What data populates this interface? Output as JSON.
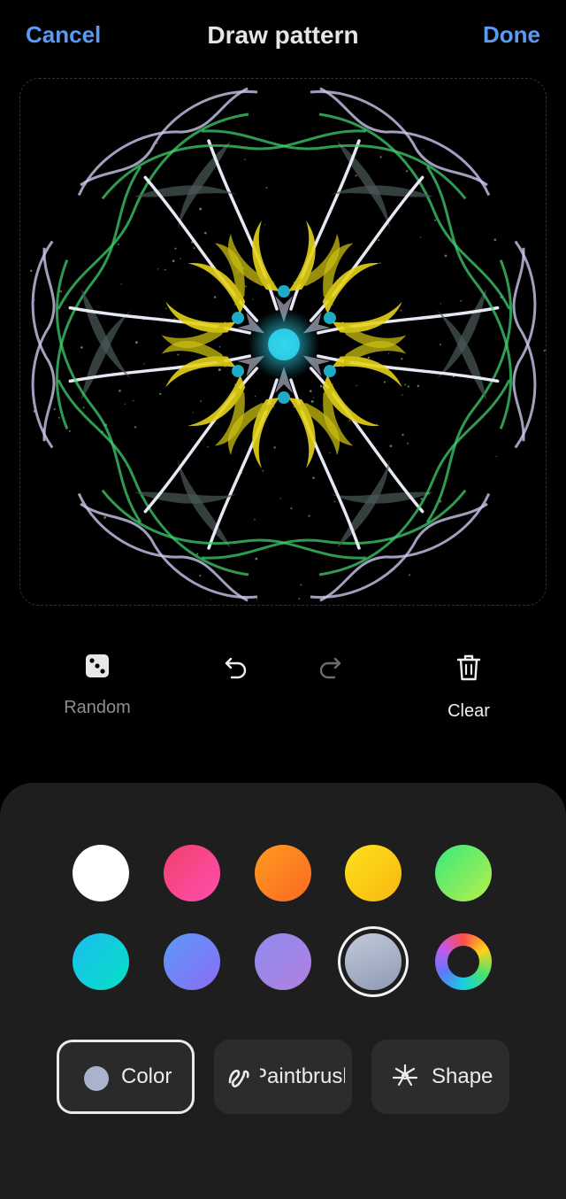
{
  "header": {
    "cancel_label": "Cancel",
    "title": "Draw pattern",
    "done_label": "Done"
  },
  "tools": {
    "random_label": "Random",
    "clear_label": "Clear",
    "undo_icon": "undo-icon",
    "redo_icon": "redo-icon"
  },
  "palette": {
    "colors": [
      {
        "name": "white",
        "fill": "#ffffff"
      },
      {
        "name": "pink",
        "fill": "#f24e78"
      },
      {
        "name": "orange",
        "fill": "#fd7f22"
      },
      {
        "name": "yellow",
        "fill": "#fdd21a"
      },
      {
        "name": "green",
        "fill": "#5ae36e"
      },
      {
        "name": "cyan",
        "fill": "#12cfd6"
      },
      {
        "name": "blue",
        "fill": "#6f8af8"
      },
      {
        "name": "purple",
        "fill": "#9f88e6"
      },
      {
        "name": "gray-blue",
        "fill": "#a9b4cc"
      },
      {
        "name": "rainbow",
        "fill": "conic"
      }
    ],
    "selected_color": "gray-blue"
  },
  "modes": {
    "color_label": "Color",
    "paintbrush_label": "Paintbrush",
    "shape_label": "Shape",
    "selected": "Color"
  },
  "accent": "#5a9af2"
}
